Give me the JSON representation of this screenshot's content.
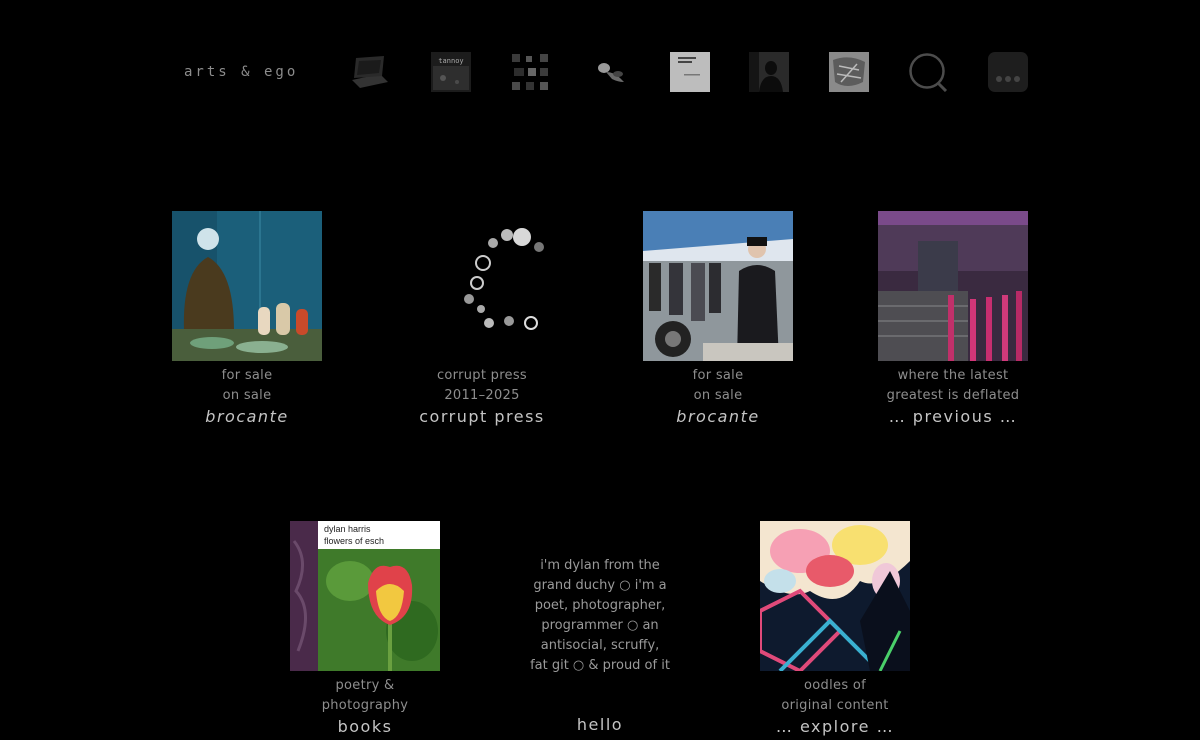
{
  "header": {
    "site_title": "arts & ego",
    "nav": [
      {
        "icon": "laptop-thumb-icon"
      },
      {
        "icon": "tannoy-thumb-icon",
        "label": "tannoy"
      },
      {
        "icon": "grid-thumb-icon"
      },
      {
        "icon": "figure-thumb-icon"
      },
      {
        "icon": "book-cover-thumb-icon"
      },
      {
        "icon": "silhouette-thumb-icon"
      },
      {
        "icon": "sketch-thumb-icon"
      },
      {
        "icon": "search-icon"
      },
      {
        "icon": "more-icon"
      }
    ]
  },
  "tiles_row1": [
    {
      "caption1": "for sale",
      "caption2": "on sale",
      "title": "brocante"
    },
    {
      "caption1": "corrupt press",
      "caption2": "2011–2025",
      "title": "corrupt press"
    },
    {
      "caption1": "for sale",
      "caption2": "on sale",
      "title": "brocante"
    },
    {
      "caption1": "where the latest",
      "caption2": "greatest is deflated",
      "title": "… previous …"
    }
  ],
  "tiles_row2": {
    "books": {
      "cover_line1": "dylan harris",
      "cover_line2": "flowers of esch",
      "caption1": "poetry &",
      "caption2": "photography",
      "title": "books"
    },
    "bio_lines": [
      "i'm dylan from the",
      "grand duchy ○ i'm a",
      "poet, photographer,",
      "programmer ○ an",
      "antisocial, scruffy,",
      "fat git ○ & proud of it"
    ],
    "hello": "hello",
    "explore": {
      "caption1": "oodles of",
      "caption2": "original content",
      "title": "… explore …"
    }
  }
}
